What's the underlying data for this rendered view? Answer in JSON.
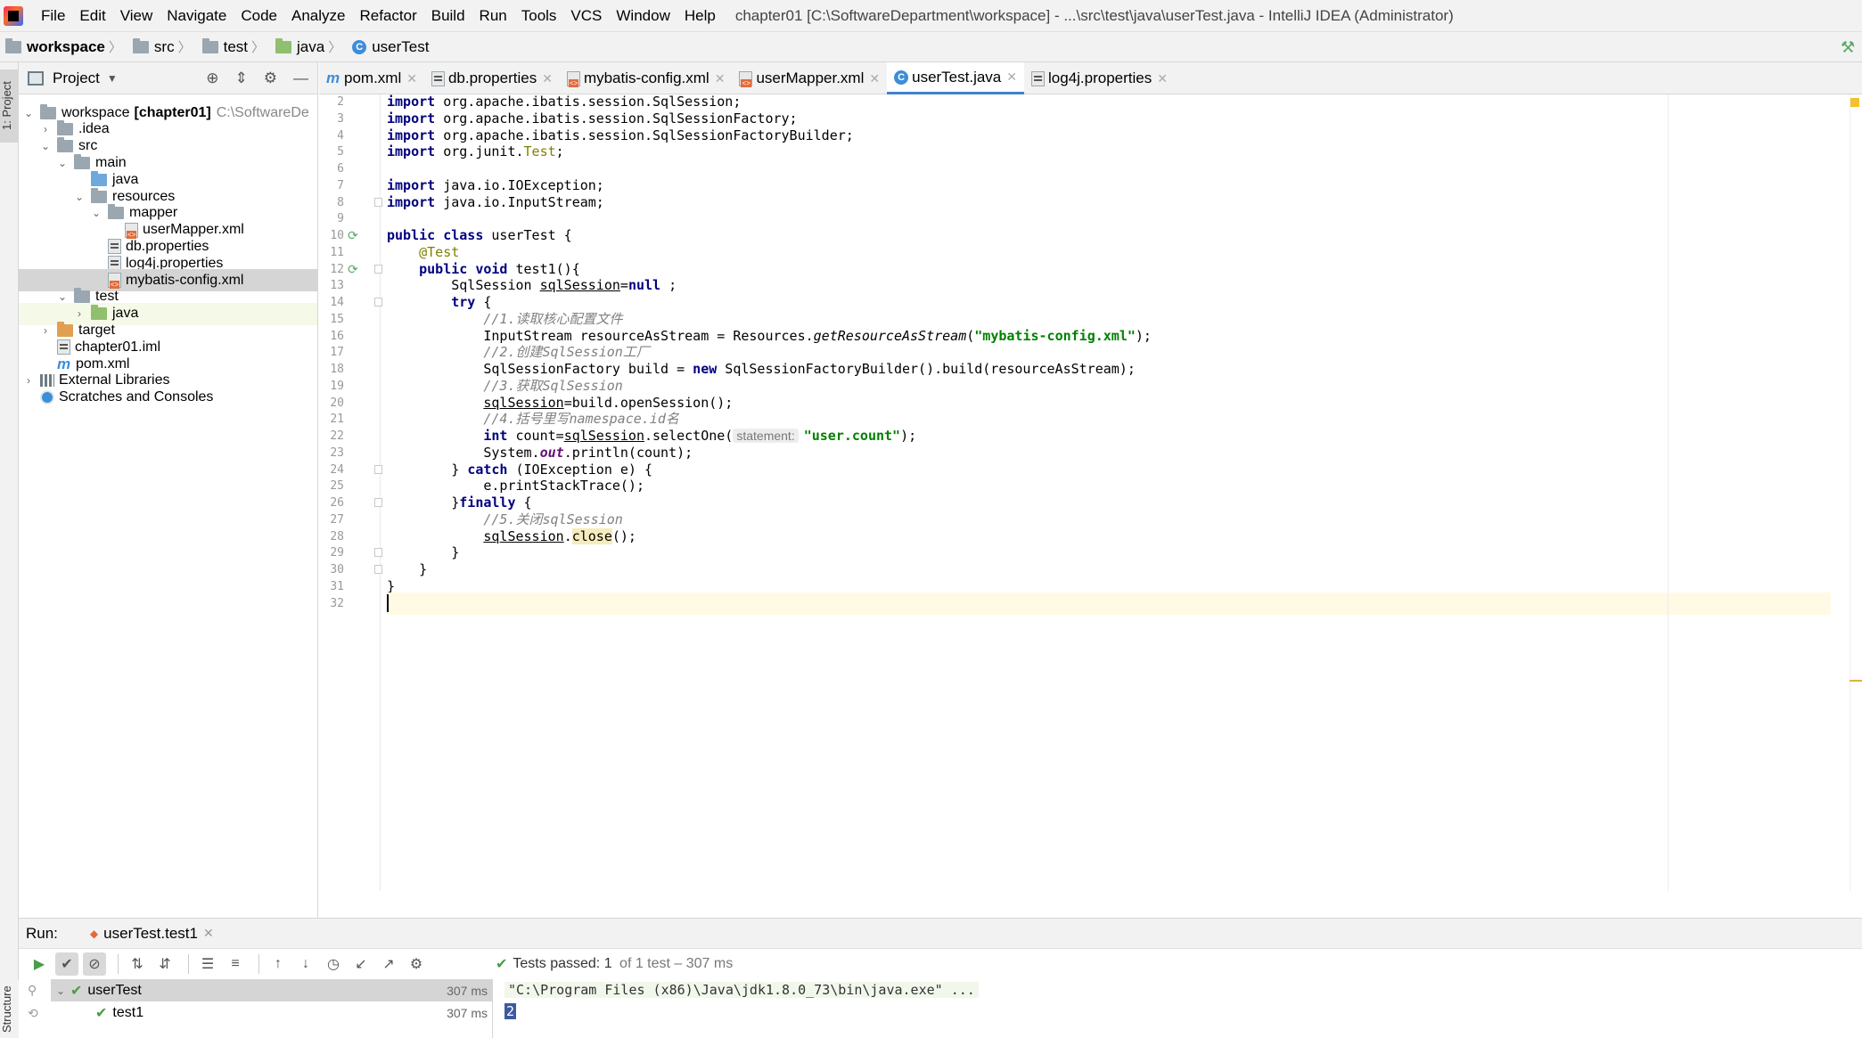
{
  "menubar": {
    "items": [
      "File",
      "Edit",
      "View",
      "Navigate",
      "Code",
      "Analyze",
      "Refactor",
      "Build",
      "Run",
      "Tools",
      "VCS",
      "Window",
      "Help"
    ],
    "title": "chapter01 [C:\\SoftwareDepartment\\workspace] - ...\\src\\test\\java\\userTest.java - IntelliJ IDEA (Administrator)"
  },
  "navbar": {
    "crumbs": [
      "workspace",
      "src",
      "test",
      "java",
      "userTest"
    ]
  },
  "left_strip": {
    "project_tab": "1: Project",
    "structure_tab": "Structure"
  },
  "project": {
    "header": "Project",
    "tree": [
      {
        "label": "workspace",
        "bold": "[chapter01]",
        "muted": "C:\\SoftwareDe",
        "indent": 0,
        "arrow": "down",
        "icon": "folder"
      },
      {
        "label": ".idea",
        "indent": 1,
        "arrow": "right",
        "icon": "folder"
      },
      {
        "label": "src",
        "indent": 1,
        "arrow": "down",
        "icon": "folder"
      },
      {
        "label": "main",
        "indent": 2,
        "arrow": "down",
        "icon": "folder"
      },
      {
        "label": "java",
        "indent": 3,
        "arrow": "",
        "icon": "folder-blue"
      },
      {
        "label": "resources",
        "indent": 3,
        "arrow": "down",
        "icon": "folder"
      },
      {
        "label": "mapper",
        "indent": 4,
        "arrow": "down",
        "icon": "folder"
      },
      {
        "label": "userMapper.xml",
        "indent": 5,
        "arrow": "",
        "icon": "xml"
      },
      {
        "label": "db.properties",
        "indent": 4,
        "arrow": "",
        "icon": "prop"
      },
      {
        "label": "log4j.properties",
        "indent": 4,
        "arrow": "",
        "icon": "prop"
      },
      {
        "label": "mybatis-config.xml",
        "indent": 4,
        "arrow": "",
        "icon": "xml"
      },
      {
        "label": "test",
        "indent": 2,
        "arrow": "down",
        "icon": "folder"
      },
      {
        "label": "java",
        "indent": 3,
        "arrow": "right",
        "icon": "folder-green"
      },
      {
        "label": "target",
        "indent": 1,
        "arrow": "right",
        "icon": "folder-orange"
      },
      {
        "label": "chapter01.iml",
        "indent": 1,
        "arrow": "",
        "icon": "prop"
      },
      {
        "label": "pom.xml",
        "indent": 1,
        "arrow": "",
        "icon": "maven"
      },
      {
        "label": "External Libraries",
        "indent": 0,
        "arrow": "right",
        "icon": "lib"
      },
      {
        "label": "Scratches and Consoles",
        "indent": 0,
        "arrow": "",
        "icon": "scratch"
      }
    ]
  },
  "tabs": [
    {
      "label": "pom.xml",
      "icon": "maven"
    },
    {
      "label": "db.properties",
      "icon": "prop"
    },
    {
      "label": "mybatis-config.xml",
      "icon": "xml"
    },
    {
      "label": "userMapper.xml",
      "icon": "xml"
    },
    {
      "label": "userTest.java",
      "icon": "class",
      "active": true
    },
    {
      "label": "log4j.properties",
      "icon": "prop"
    }
  ],
  "editor": {
    "line_numbers": [
      "2",
      "3",
      "4",
      "5",
      "6",
      "7",
      "8",
      "9",
      "10",
      "11",
      "12",
      "13",
      "14",
      "15",
      "16",
      "17",
      "18",
      "19",
      "20",
      "21",
      "22",
      "23",
      "24",
      "25",
      "26",
      "27",
      "28",
      "29",
      "30",
      "31",
      "32"
    ],
    "lines": [
      [
        [
          "kw",
          "import"
        ],
        [
          "",
          "org.apache.ibatis.session.SqlSession;"
        ]
      ],
      [
        [
          "kw",
          "import"
        ],
        [
          "",
          "org.apache.ibatis.session.SqlSessionFactory;"
        ]
      ],
      [
        [
          "kw",
          "import"
        ],
        [
          "",
          "org.apache.ibatis.session.SqlSessionFactoryBuilder;"
        ]
      ],
      [
        [
          "kw",
          "import"
        ],
        [
          "",
          "org.junit."
        ],
        [
          "ann",
          "Test"
        ],
        [
          "",
          ";"
        ]
      ],
      [],
      [
        [
          "kw",
          "import"
        ],
        [
          "",
          "java.io.IOException;"
        ]
      ],
      [
        [
          "kw",
          "import"
        ],
        [
          "",
          "java.io.InputStream;"
        ]
      ],
      [],
      [
        [
          "kw",
          "public class"
        ],
        [
          "",
          "userTest {"
        ]
      ],
      [
        [
          "ann",
          "    @Test"
        ]
      ],
      [
        [
          "kw",
          "    public void"
        ],
        [
          "",
          "test1(){"
        ]
      ],
      [
        [
          "",
          "        SqlSession "
        ],
        [
          "ul",
          "sqlSession"
        ],
        [
          "",
          "="
        ],
        [
          "kw",
          "null"
        ],
        [
          "",
          ";"
        ]
      ],
      [
        [
          "kw",
          "        try"
        ],
        [
          "",
          "{"
        ]
      ],
      [
        [
          "cmt",
          "            //1.读取核心配置文件"
        ]
      ],
      [
        [
          "",
          "            InputStream resourceAsStream = Resources."
        ],
        [
          "it",
          "getResourceAsStream"
        ],
        [
          "",
          "("
        ],
        [
          "str",
          "\"mybatis-config.xml\""
        ],
        [
          "",
          ");"
        ]
      ],
      [
        [
          "cmt",
          "            //2.创建SqlSession工厂"
        ]
      ],
      [
        [
          "",
          "            SqlSessionFactory build = "
        ],
        [
          "kw",
          "new"
        ],
        [
          "",
          "SqlSessionFactoryBuilder().build(resourceAsStream);"
        ]
      ],
      [
        [
          "cmt",
          "            //3.获取SqlSession"
        ]
      ],
      [
        [
          "",
          "            "
        ],
        [
          "ul",
          "sqlSession"
        ],
        [
          "",
          "=build.openSession();"
        ]
      ],
      [
        [
          "cmt",
          "            //4.括号里写namespace.id名"
        ]
      ],
      [
        [
          "kw",
          "            int"
        ],
        [
          "",
          "count="
        ],
        [
          "ul",
          "sqlSession"
        ],
        [
          "",
          ".selectOne("
        ],
        [
          "hint",
          "statement:"
        ],
        [
          "str",
          "\"user.count\""
        ],
        [
          "",
          ");"
        ]
      ],
      [
        [
          "",
          "            System."
        ],
        [
          "sf",
          "out"
        ],
        [
          "",
          ".println(count);"
        ]
      ],
      [
        [
          "",
          "        } "
        ],
        [
          "kw",
          "catch"
        ],
        [
          "",
          "(IOException e) {"
        ]
      ],
      [
        [
          "",
          "            e.printStackTrace();"
        ]
      ],
      [
        [
          "",
          "        }"
        ],
        [
          "kw",
          "finally"
        ],
        [
          "",
          "{"
        ]
      ],
      [
        [
          "cmt",
          "            //5.关闭sqlSession"
        ]
      ],
      [
        [
          "",
          "            "
        ],
        [
          "ul",
          "sqlSession"
        ],
        [
          "",
          "."
        ],
        [
          "hlw",
          "close"
        ],
        [
          "",
          "();"
        ]
      ],
      [
        [
          "",
          "        }"
        ]
      ],
      [
        [
          "",
          "    }"
        ]
      ],
      [
        [
          "",
          "}"
        ]
      ],
      [
        [
          "caret",
          ""
        ]
      ]
    ]
  },
  "run": {
    "label": "Run:",
    "tab": "userTest.test1",
    "status_prefix": "Tests passed:",
    "status_count": "1",
    "status_rest": "of 1 test – 307 ms",
    "tests": [
      {
        "name": "userTest",
        "time": "307 ms"
      },
      {
        "name": "test1",
        "time": "307 ms"
      }
    ],
    "console": {
      "command": "\"C:\\Program Files (x86)\\Java\\jdk1.8.0_73\\bin\\java.exe\" ...",
      "output": "2"
    }
  }
}
